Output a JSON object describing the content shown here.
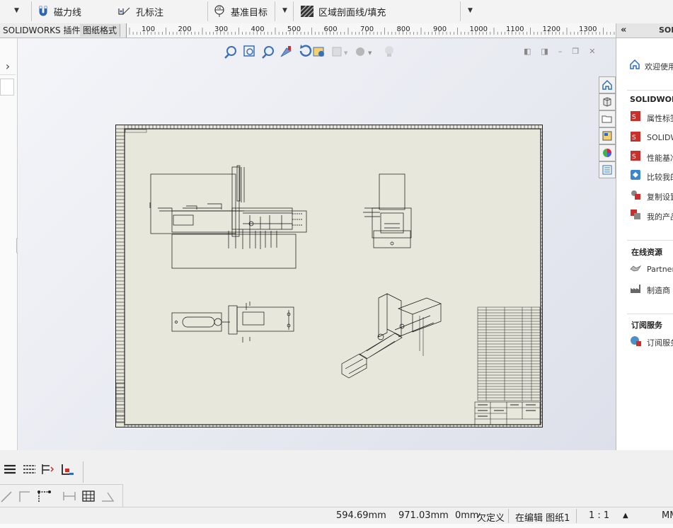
{
  "toolbar": {
    "magnetic_line": "磁力线",
    "hole_callout": "孔标注",
    "datum_target": "基准目标",
    "area_hatch": "区域剖面线/填充"
  },
  "tabs": {
    "addins": "SOLIDWORKS 插件",
    "sheet_format": "图纸格式"
  },
  "ruler": {
    "ticks": [
      "100",
      "200",
      "300",
      "400",
      "500",
      "600",
      "700",
      "800",
      "900",
      "1000",
      "1100",
      "1200",
      "1300"
    ]
  },
  "taskpane": {
    "title": "SOL",
    "welcome": "欢迎使用",
    "section_sw": "SOLIDWORK",
    "items_sw": [
      "属性标签",
      "SOLIDW",
      "性能基准",
      "比较我的",
      "复制设置",
      "我的产品"
    ],
    "section_online": "在线资源",
    "items_online": [
      "Partner",
      "制造商"
    ],
    "section_subscription": "订阅服务",
    "items_subscription": [
      "订阅服务"
    ]
  },
  "status": {
    "x": "594.69mm",
    "y": "971.03mm",
    "z": "0mm",
    "definition": "欠定义",
    "editing": "在编辑 图纸1",
    "scale": "1 : 1",
    "units": "MM"
  },
  "colors": {
    "sheet_bg": "#e7e7dc",
    "accent_blue": "#2a6cc4",
    "sw_red": "#c9302c"
  }
}
